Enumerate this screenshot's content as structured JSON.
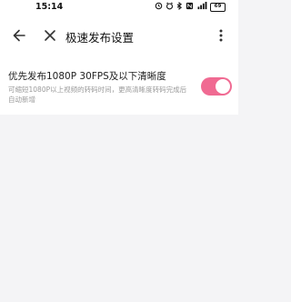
{
  "status_bar": {
    "time": "15:14",
    "icons": [
      "alarm-icon",
      "clock-icon",
      "bluetooth-icon",
      "nfc-icon",
      "signal-icon"
    ],
    "signal_label": "5G",
    "battery": "69"
  },
  "app_bar": {
    "title": "极速发布设置",
    "back_icon": "arrow-left-icon",
    "close_icon": "close-icon",
    "more_icon": "more-vert-icon"
  },
  "settings": [
    {
      "title": "优先发布1080P 30FPS及以下清晰度",
      "description": "可缩短1080P以上视频的转码时间，更高清晰度转码完成后自动新增",
      "enabled": true
    }
  ],
  "colors": {
    "accent": "#f06a92",
    "background": "#f4f4f6",
    "surface": "#ffffff"
  }
}
